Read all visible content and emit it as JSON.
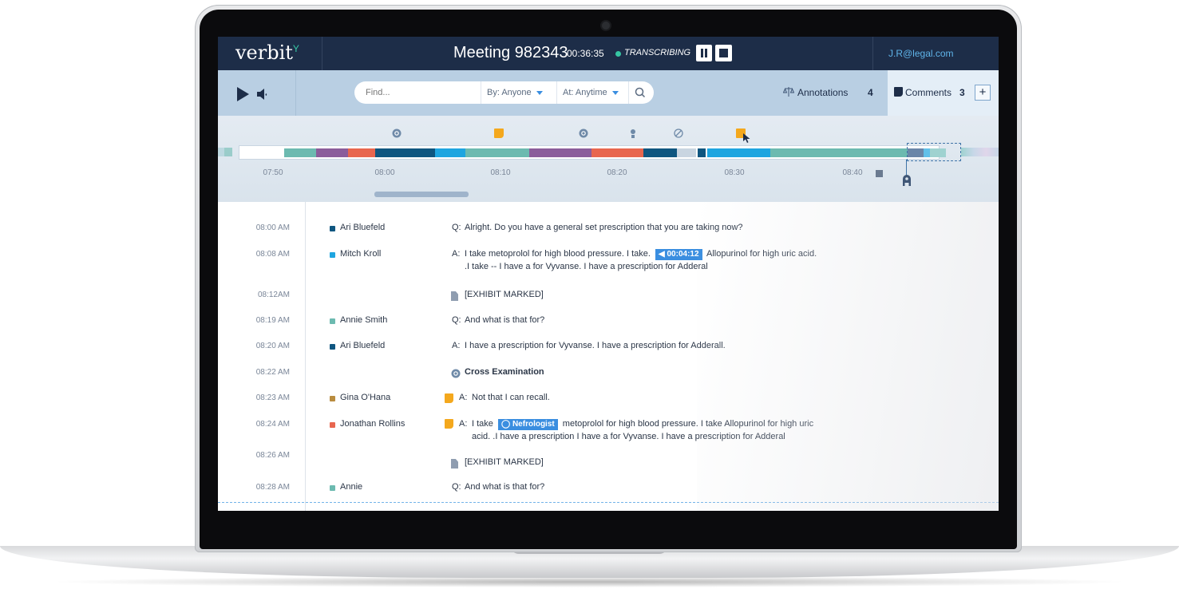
{
  "header": {
    "logo": "verbit",
    "logo_mark": "Y",
    "meeting_title": "Meeting 982343",
    "elapsed": "00:36:35",
    "status": "TRANSCRIBING",
    "user_email": "J.R@legal.com"
  },
  "toolbar": {
    "search_placeholder": "Find...",
    "by_filter": "By: Anyone",
    "at_filter": "At: Anytime",
    "annotations_label": "Annotations",
    "annotations_count": "4",
    "comments_label": "Comments",
    "comments_count": "3",
    "add_label": "+"
  },
  "timeline": {
    "ticks": [
      "07:50",
      "08:00",
      "08:10",
      "08:20",
      "08:30",
      "08:40"
    ],
    "markers": [
      "section-icon",
      "comment-icon",
      "section-icon",
      "witness-icon",
      "strike-icon",
      "comment-icon"
    ]
  },
  "colors": {
    "navy": "#1d2d48",
    "accent_blue": "#3a8ee0",
    "teal": "#6cbab0",
    "purple": "#8b5d9b",
    "coral": "#e8664f",
    "dark_blue": "#0f5680",
    "cyan": "#1ea5e0",
    "gold": "#b98c3f",
    "note_orange": "#f4a81d"
  },
  "transcript": [
    {
      "time": "08:00 AM",
      "speaker": "Ari Bluefeld",
      "color": "#0f5680",
      "qa": "Q:",
      "text": "Alright. Do you have a general set prescription that you are taking now?"
    },
    {
      "time": "08:08 AM",
      "speaker": "Mitch Kroll",
      "color": "#1ea5e0",
      "qa": "A:",
      "text_a": "I take metoprolol for high blood pressure. I take.",
      "chip": "00:04:12",
      "text_b": "Allopurinol for high uric acid.",
      "text_c": ".I take -- I have a for Vyvanse. I have a prescription for Adderal"
    },
    {
      "time": "08:12AM",
      "exhibit": "[EXHIBIT MARKED]"
    },
    {
      "time": "08:19 AM",
      "speaker": "Annie Smith",
      "color": "#6cbab0",
      "qa": "Q:",
      "text": "And what is that for?"
    },
    {
      "time": "08:20 AM",
      "speaker": "Ari Bluefeld",
      "color": "#0f5680",
      "qa": "A:",
      "text": "I have a prescription for Vyvanse. I have a prescription for Adderall."
    },
    {
      "time": "08:22 AM",
      "section": "Cross Examination"
    },
    {
      "time": "08:23 AM",
      "speaker": "Gina O'Hana",
      "color": "#b98c3f",
      "qa": "A:",
      "text": "Not that I can recall."
    },
    {
      "time": "08:24 AM",
      "speaker": "Jonathan Rollins",
      "color": "#e8664f",
      "qa": "A:",
      "text_a": "I take",
      "chip": "Nefrologist",
      "text_b": "metoprolol for high blood pressure. I take Allopurinol for high uric",
      "text_c": "acid. .I have a prescription I have a for Vyvanse. I have a prescription for Adderal"
    },
    {
      "time": "08:26 AM",
      "exhibit": "[EXHIBIT MARKED]"
    },
    {
      "time": "08:28 AM",
      "speaker": "Annie",
      "color": "#6cbab0",
      "qa": "Q:",
      "text": "And what is that for?"
    }
  ]
}
